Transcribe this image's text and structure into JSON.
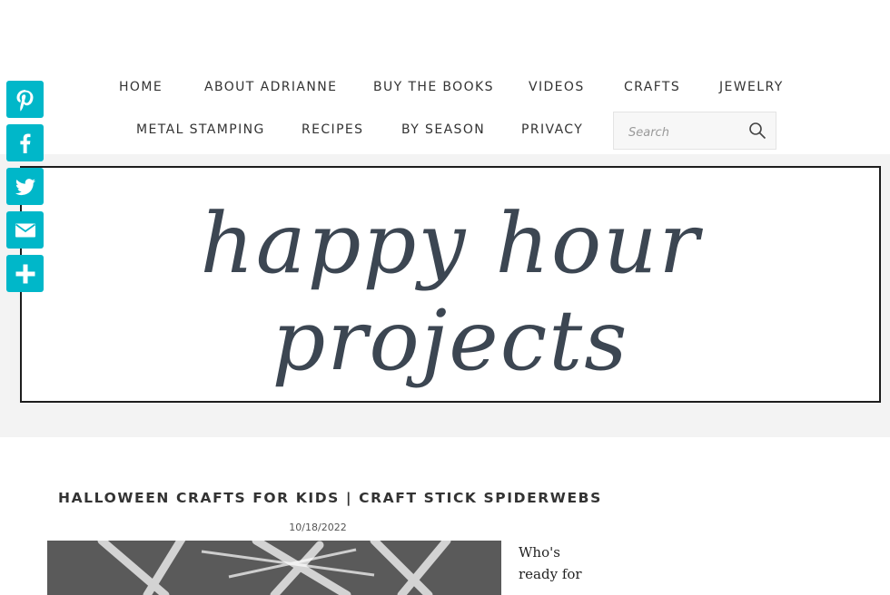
{
  "nav": {
    "row1": [
      "HOME",
      "ABOUT ADRIANNE",
      "BUY THE BOOKS",
      "VIDEOS",
      "CRAFTS",
      "JEWELRY"
    ],
    "row2": [
      "METAL STAMPING",
      "RECIPES",
      "BY SEASON",
      "PRIVACY"
    ]
  },
  "search": {
    "placeholder": "Search",
    "icon": "search-icon"
  },
  "share": [
    "pinterest-icon",
    "facebook-icon",
    "twitter-icon",
    "email-icon",
    "plus-icon"
  ],
  "colors": {
    "share_accent": "#00b7c9",
    "banner_text": "#3c4652",
    "banner_bg": "#f3f3f3"
  },
  "banner": {
    "title": "happy hour projects"
  },
  "post": {
    "title": "HALLOWEEN CRAFTS FOR KIDS | CRAFT STICK SPIDERWEBS",
    "date": "10/18/2022",
    "excerpt": "Who's ready for"
  }
}
